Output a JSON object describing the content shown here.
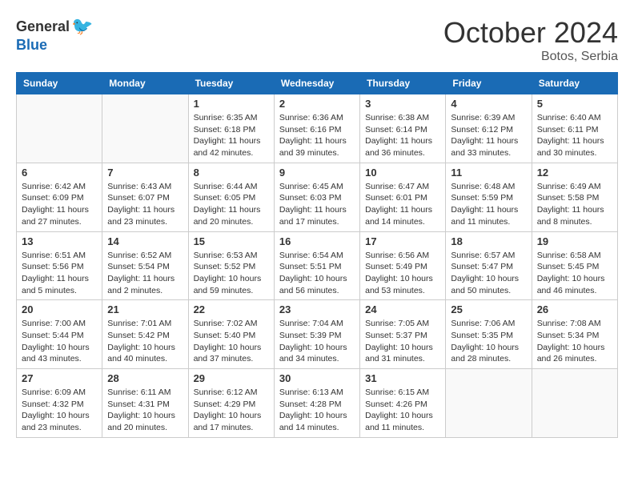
{
  "header": {
    "logo_general": "General",
    "logo_blue": "Blue",
    "month": "October 2024",
    "location": "Botos, Serbia"
  },
  "weekdays": [
    "Sunday",
    "Monday",
    "Tuesday",
    "Wednesday",
    "Thursday",
    "Friday",
    "Saturday"
  ],
  "weeks": [
    [
      {
        "day": "",
        "info": ""
      },
      {
        "day": "",
        "info": ""
      },
      {
        "day": "1",
        "info": "Sunrise: 6:35 AM\nSunset: 6:18 PM\nDaylight: 11 hours and 42 minutes."
      },
      {
        "day": "2",
        "info": "Sunrise: 6:36 AM\nSunset: 6:16 PM\nDaylight: 11 hours and 39 minutes."
      },
      {
        "day": "3",
        "info": "Sunrise: 6:38 AM\nSunset: 6:14 PM\nDaylight: 11 hours and 36 minutes."
      },
      {
        "day": "4",
        "info": "Sunrise: 6:39 AM\nSunset: 6:12 PM\nDaylight: 11 hours and 33 minutes."
      },
      {
        "day": "5",
        "info": "Sunrise: 6:40 AM\nSunset: 6:11 PM\nDaylight: 11 hours and 30 minutes."
      }
    ],
    [
      {
        "day": "6",
        "info": "Sunrise: 6:42 AM\nSunset: 6:09 PM\nDaylight: 11 hours and 27 minutes."
      },
      {
        "day": "7",
        "info": "Sunrise: 6:43 AM\nSunset: 6:07 PM\nDaylight: 11 hours and 23 minutes."
      },
      {
        "day": "8",
        "info": "Sunrise: 6:44 AM\nSunset: 6:05 PM\nDaylight: 11 hours and 20 minutes."
      },
      {
        "day": "9",
        "info": "Sunrise: 6:45 AM\nSunset: 6:03 PM\nDaylight: 11 hours and 17 minutes."
      },
      {
        "day": "10",
        "info": "Sunrise: 6:47 AM\nSunset: 6:01 PM\nDaylight: 11 hours and 14 minutes."
      },
      {
        "day": "11",
        "info": "Sunrise: 6:48 AM\nSunset: 5:59 PM\nDaylight: 11 hours and 11 minutes."
      },
      {
        "day": "12",
        "info": "Sunrise: 6:49 AM\nSunset: 5:58 PM\nDaylight: 11 hours and 8 minutes."
      }
    ],
    [
      {
        "day": "13",
        "info": "Sunrise: 6:51 AM\nSunset: 5:56 PM\nDaylight: 11 hours and 5 minutes."
      },
      {
        "day": "14",
        "info": "Sunrise: 6:52 AM\nSunset: 5:54 PM\nDaylight: 11 hours and 2 minutes."
      },
      {
        "day": "15",
        "info": "Sunrise: 6:53 AM\nSunset: 5:52 PM\nDaylight: 10 hours and 59 minutes."
      },
      {
        "day": "16",
        "info": "Sunrise: 6:54 AM\nSunset: 5:51 PM\nDaylight: 10 hours and 56 minutes."
      },
      {
        "day": "17",
        "info": "Sunrise: 6:56 AM\nSunset: 5:49 PM\nDaylight: 10 hours and 53 minutes."
      },
      {
        "day": "18",
        "info": "Sunrise: 6:57 AM\nSunset: 5:47 PM\nDaylight: 10 hours and 50 minutes."
      },
      {
        "day": "19",
        "info": "Sunrise: 6:58 AM\nSunset: 5:45 PM\nDaylight: 10 hours and 46 minutes."
      }
    ],
    [
      {
        "day": "20",
        "info": "Sunrise: 7:00 AM\nSunset: 5:44 PM\nDaylight: 10 hours and 43 minutes."
      },
      {
        "day": "21",
        "info": "Sunrise: 7:01 AM\nSunset: 5:42 PM\nDaylight: 10 hours and 40 minutes."
      },
      {
        "day": "22",
        "info": "Sunrise: 7:02 AM\nSunset: 5:40 PM\nDaylight: 10 hours and 37 minutes."
      },
      {
        "day": "23",
        "info": "Sunrise: 7:04 AM\nSunset: 5:39 PM\nDaylight: 10 hours and 34 minutes."
      },
      {
        "day": "24",
        "info": "Sunrise: 7:05 AM\nSunset: 5:37 PM\nDaylight: 10 hours and 31 minutes."
      },
      {
        "day": "25",
        "info": "Sunrise: 7:06 AM\nSunset: 5:35 PM\nDaylight: 10 hours and 28 minutes."
      },
      {
        "day": "26",
        "info": "Sunrise: 7:08 AM\nSunset: 5:34 PM\nDaylight: 10 hours and 26 minutes."
      }
    ],
    [
      {
        "day": "27",
        "info": "Sunrise: 6:09 AM\nSunset: 4:32 PM\nDaylight: 10 hours and 23 minutes."
      },
      {
        "day": "28",
        "info": "Sunrise: 6:11 AM\nSunset: 4:31 PM\nDaylight: 10 hours and 20 minutes."
      },
      {
        "day": "29",
        "info": "Sunrise: 6:12 AM\nSunset: 4:29 PM\nDaylight: 10 hours and 17 minutes."
      },
      {
        "day": "30",
        "info": "Sunrise: 6:13 AM\nSunset: 4:28 PM\nDaylight: 10 hours and 14 minutes."
      },
      {
        "day": "31",
        "info": "Sunrise: 6:15 AM\nSunset: 4:26 PM\nDaylight: 10 hours and 11 minutes."
      },
      {
        "day": "",
        "info": ""
      },
      {
        "day": "",
        "info": ""
      }
    ]
  ]
}
